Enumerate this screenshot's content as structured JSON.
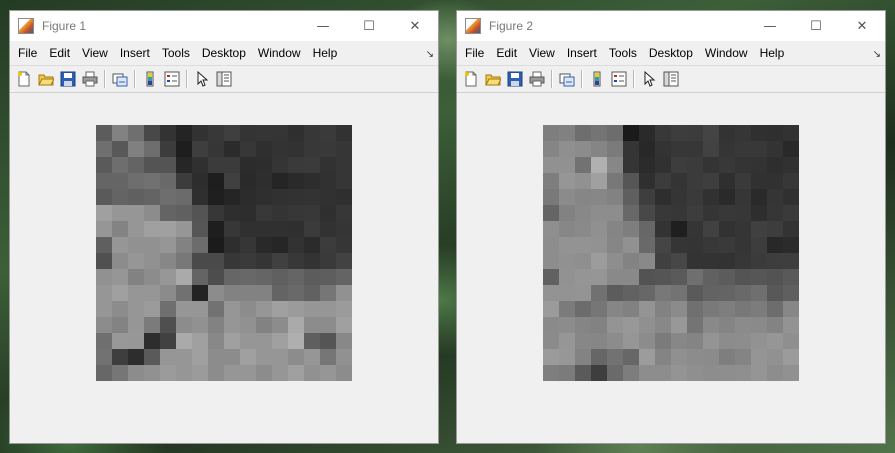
{
  "windows": [
    {
      "title": "Figure 1",
      "image": [
        [
          92,
          130,
          111,
          72,
          51,
          36,
          50,
          56,
          63,
          52,
          53,
          53,
          47,
          55,
          58,
          50
        ],
        [
          111,
          88,
          128,
          110,
          60,
          30,
          62,
          54,
          43,
          55,
          47,
          51,
          50,
          56,
          57,
          54
        ],
        [
          90,
          110,
          100,
          84,
          84,
          38,
          48,
          59,
          59,
          44,
          45,
          53,
          58,
          59,
          50,
          54
        ],
        [
          101,
          101,
          110,
          113,
          105,
          60,
          45,
          30,
          64,
          42,
          46,
          37,
          42,
          45,
          49,
          54
        ],
        [
          90,
          100,
          96,
          100,
          110,
          107,
          47,
          31,
          37,
          44,
          47,
          49,
          50,
          51,
          49,
          47
        ],
        [
          160,
          150,
          150,
          140,
          100,
          96,
          84,
          55,
          46,
          45,
          56,
          52,
          55,
          56,
          47,
          55
        ],
        [
          150,
          131,
          150,
          160,
          160,
          150,
          86,
          30,
          55,
          48,
          48,
          48,
          47,
          59,
          50,
          53
        ],
        [
          95,
          150,
          145,
          145,
          150,
          130,
          108,
          27,
          46,
          54,
          41,
          38,
          50,
          43,
          60,
          54
        ],
        [
          80,
          140,
          150,
          145,
          135,
          120,
          74,
          74,
          55,
          58,
          53,
          64,
          56,
          51,
          58,
          66
        ],
        [
          145,
          150,
          130,
          140,
          151,
          170,
          100,
          77,
          102,
          104,
          101,
          96,
          101,
          92,
          94,
          100
        ],
        [
          150,
          160,
          150,
          150,
          139,
          113,
          35,
          140,
          130,
          130,
          130,
          100,
          105,
          97,
          118,
          145
        ],
        [
          150,
          140,
          150,
          155,
          111,
          150,
          150,
          114,
          150,
          140,
          150,
          160,
          155,
          150,
          150,
          155
        ],
        [
          140,
          131,
          150,
          123,
          79,
          140,
          145,
          130,
          150,
          145,
          130,
          140,
          170,
          140,
          140,
          160
        ],
        [
          111,
          152,
          151,
          45,
          65,
          170,
          160,
          136,
          160,
          150,
          150,
          160,
          175,
          95,
          85,
          136
        ],
        [
          114,
          62,
          45,
          90,
          150,
          150,
          160,
          140,
          140,
          160,
          150,
          150,
          140,
          150,
          118,
          145
        ],
        [
          103,
          118,
          140,
          145,
          155,
          150,
          155,
          140,
          150,
          150,
          140,
          150,
          160,
          145,
          150,
          140
        ]
      ]
    },
    {
      "title": "Figure 2",
      "image": [
        [
          126,
          129,
          110,
          116,
          109,
          26,
          42,
          56,
          61,
          60,
          68,
          51,
          54,
          48,
          47,
          50
        ],
        [
          133,
          143,
          140,
          133,
          123,
          53,
          40,
          51,
          55,
          55,
          66,
          53,
          56,
          56,
          51,
          41
        ],
        [
          145,
          145,
          114,
          176,
          135,
          53,
          43,
          49,
          61,
          59,
          52,
          56,
          52,
          51,
          46,
          49
        ],
        [
          126,
          150,
          145,
          160,
          120,
          86,
          47,
          60,
          52,
          59,
          62,
          47,
          58,
          49,
          49,
          55
        ],
        [
          121,
          139,
          134,
          135,
          130,
          95,
          62,
          46,
          53,
          58,
          49,
          42,
          54,
          42,
          53,
          48
        ],
        [
          101,
          130,
          136,
          141,
          141,
          104,
          72,
          56,
          55,
          61,
          53,
          56,
          55,
          46,
          54,
          58
        ],
        [
          143,
          135,
          138,
          144,
          133,
          126,
          103,
          51,
          31,
          53,
          65,
          50,
          53,
          64,
          61,
          51
        ],
        [
          141,
          147,
          147,
          146,
          134,
          145,
          105,
          69,
          53,
          52,
          56,
          58,
          53,
          61,
          40,
          43
        ],
        [
          141,
          145,
          143,
          156,
          142,
          131,
          137,
          64,
          71,
          51,
          51,
          50,
          55,
          59,
          61,
          62
        ],
        [
          97,
          146,
          149,
          150,
          137,
          137,
          83,
          85,
          90,
          111,
          97,
          92,
          84,
          86,
          83,
          89
        ],
        [
          147,
          147,
          148,
          113,
          92,
          98,
          103,
          120,
          115,
          90,
          99,
          100,
          105,
          111,
          88,
          95
        ],
        [
          155,
          123,
          108,
          118,
          134,
          129,
          148,
          130,
          139,
          112,
          121,
          126,
          120,
          124,
          109,
          135
        ],
        [
          138,
          140,
          133,
          130,
          148,
          152,
          144,
          136,
          152,
          116,
          137,
          132,
          139,
          138,
          131,
          147
        ],
        [
          139,
          150,
          135,
          134,
          140,
          150,
          140,
          123,
          135,
          132,
          148,
          140,
          141,
          146,
          150,
          143
        ],
        [
          155,
          151,
          131,
          102,
          114,
          103,
          156,
          132,
          144,
          140,
          139,
          126,
          132,
          149,
          145,
          155
        ],
        [
          126,
          123,
          90,
          62,
          106,
          125,
          141,
          141,
          148,
          143,
          141,
          142,
          143,
          149,
          141,
          145
        ]
      ]
    }
  ],
  "menus": [
    "File",
    "Edit",
    "View",
    "Insert",
    "Tools",
    "Desktop",
    "Window",
    "Help"
  ],
  "toolbar_icons": [
    "new-figure-icon",
    "open-file-icon",
    "save-icon",
    "print-icon",
    "link-plot-icon",
    "insert-colorbar-icon",
    "insert-legend-icon",
    "edit-plot-icon",
    "open-property-inspector-icon"
  ]
}
